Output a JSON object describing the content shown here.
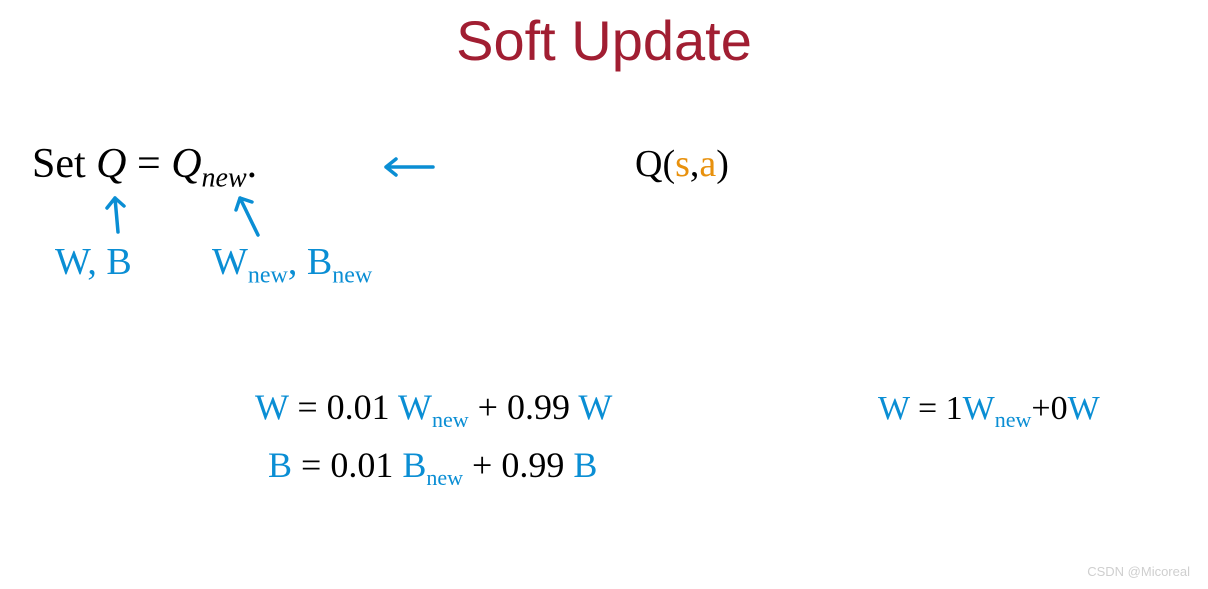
{
  "title": "Soft Update",
  "set_line": {
    "set_label": "Set ",
    "q": "Q",
    "eq": " = ",
    "q2": "Q",
    "sub": "new",
    "dot": "."
  },
  "q_sa": {
    "q": "Q",
    "open": "(",
    "s": "s",
    "comma": ",",
    "a": "a",
    "close": ")"
  },
  "annotations": {
    "wb": "W, B",
    "wnew": "W",
    "wnew_sub": "new",
    "bnew": ", B",
    "bnew_sub": "new"
  },
  "equations": {
    "w": {
      "lhs": "W",
      "eq": " = ",
      "c1": "0.01 ",
      "var1": "W",
      "sub1": "new",
      "plus": " + ",
      "c2": "0.99 ",
      "var2": "W"
    },
    "b": {
      "lhs": "B",
      "eq": " = ",
      "c1": "0.01 ",
      "var1": "B",
      "sub1": "new",
      "plus": " + ",
      "c2": "0.99 ",
      "var2": "B"
    },
    "right": {
      "lhs": "W",
      "eq": " = ",
      "c1": "1",
      "var1": "W",
      "sub1": "new",
      "plus": "+",
      "c2": "0",
      "var2": "W"
    }
  },
  "watermark": "CSDN @Micoreal"
}
